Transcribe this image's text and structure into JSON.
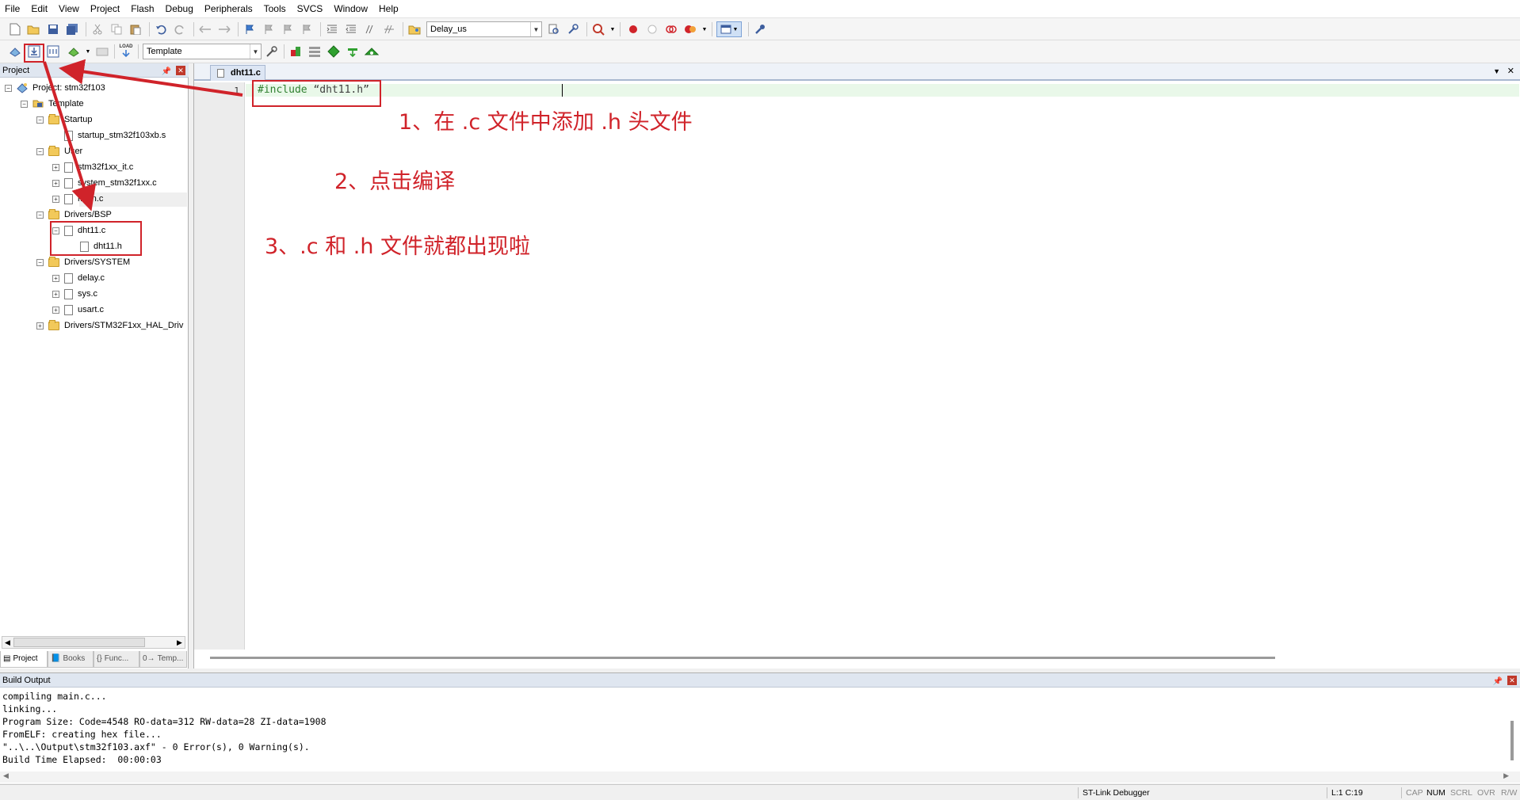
{
  "menu": [
    "File",
    "Edit",
    "View",
    "Project",
    "Flash",
    "Debug",
    "Peripherals",
    "Tools",
    "SVCS",
    "Window",
    "Help"
  ],
  "toolbar1": {
    "find_combo_value": "Delay_us"
  },
  "toolbar2": {
    "target_combo_value": "Template",
    "load_label": "LOAD"
  },
  "project_panel": {
    "title": "Project",
    "tree": [
      {
        "label": "Project: stm32f103"
      },
      {
        "label": "Template"
      },
      {
        "label": "Startup"
      },
      {
        "label": "startup_stm32f103xb.s"
      },
      {
        "label": "User"
      },
      {
        "label": "stm32f1xx_it.c"
      },
      {
        "label": "system_stm32f1xx.c"
      },
      {
        "label": "main.c"
      },
      {
        "label": "Drivers/BSP"
      },
      {
        "label": "dht11.c"
      },
      {
        "label": "dht11.h"
      },
      {
        "label": "Drivers/SYSTEM"
      },
      {
        "label": "delay.c"
      },
      {
        "label": "sys.c"
      },
      {
        "label": "usart.c"
      },
      {
        "label": "Drivers/STM32F1xx_HAL_Driv"
      }
    ],
    "tabs": [
      "Project",
      "Books",
      "Func...",
      "Temp..."
    ]
  },
  "editor": {
    "tab_label": "dht11.c",
    "line_number": "1",
    "code_keyword": "#include",
    "code_string": "“dht11.h”"
  },
  "annotations": {
    "step1": "1、在 .c 文件中添加 .h 头文件",
    "step2": "2、点击编译",
    "step3": "3、.c 和 .h 文件就都出现啦",
    "color": "#d0232a"
  },
  "build_output": {
    "title": "Build Output",
    "lines": [
      "compiling main.c...",
      "linking...",
      "Program Size: Code=4548 RO-data=312 RW-data=28 ZI-data=1908",
      "FromELF: creating hex file...",
      "\"..\\..\\Output\\stm32f103.axf\" - 0 Error(s), 0 Warning(s).",
      "Build Time Elapsed:  00:00:03"
    ]
  },
  "status": {
    "debugger": "ST-Link Debugger",
    "position": "L:1 C:19",
    "cap": "CAP",
    "num": "NUM",
    "scrl": "SCRL",
    "ovr": "OVR",
    "rw": "R/W"
  }
}
